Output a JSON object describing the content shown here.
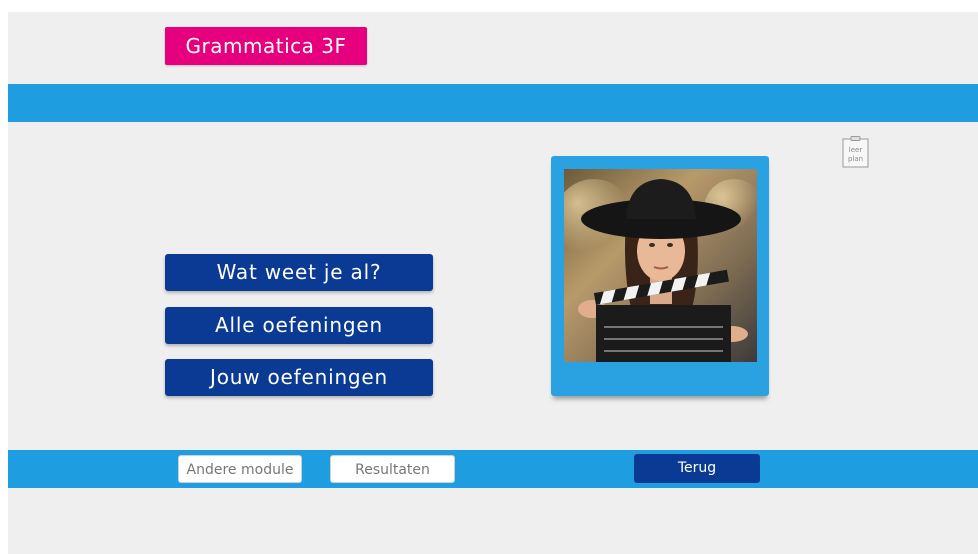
{
  "header": {
    "module_title": "Grammatica 3F"
  },
  "leerplan": {
    "line1": "leer",
    "line2": "plan"
  },
  "menu": {
    "buttons": [
      {
        "label": "Wat weet je al?"
      },
      {
        "label": "Alle oefeningen"
      },
      {
        "label": "Jouw oefeningen"
      }
    ]
  },
  "illustration": {
    "icon": "woman-with-clapperboard-photo"
  },
  "footer": {
    "other_module_label": "Andere module",
    "results_label": "Resultaten",
    "back_label": "Terug"
  },
  "colors": {
    "brand_pink": "#e6007e",
    "band_blue": "#1e9ee0",
    "button_navy": "#0a3a94",
    "background": "#efefef"
  }
}
